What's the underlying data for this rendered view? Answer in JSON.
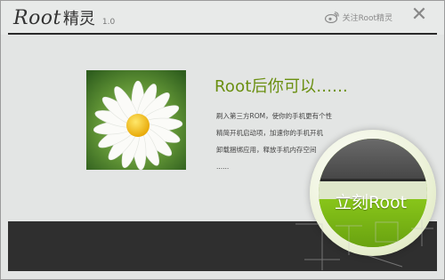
{
  "titlebar": {
    "brand_en": "Root",
    "brand_cn": "精灵",
    "version": "1.0",
    "follow_label": "关注Root精灵",
    "close_glyph": "✕"
  },
  "content": {
    "headline": "Root后你可以......",
    "features": [
      "刷入第三方ROM，使你的手机更有个性",
      "精简开机启动项，加速你的手机开机",
      "卸载捆绑应用，释放手机内存空间",
      "......"
    ]
  },
  "action": {
    "root_button_label": "立刻Root"
  },
  "colors": {
    "accent_green": "#78b312",
    "headline_green": "#6a8f10",
    "footer_dark": "#2f2f2f",
    "body_bg": "#e3e5e4"
  },
  "icons": {
    "weibo": "weibo-icon",
    "close": "close-icon",
    "photo": "daisy-photo"
  }
}
